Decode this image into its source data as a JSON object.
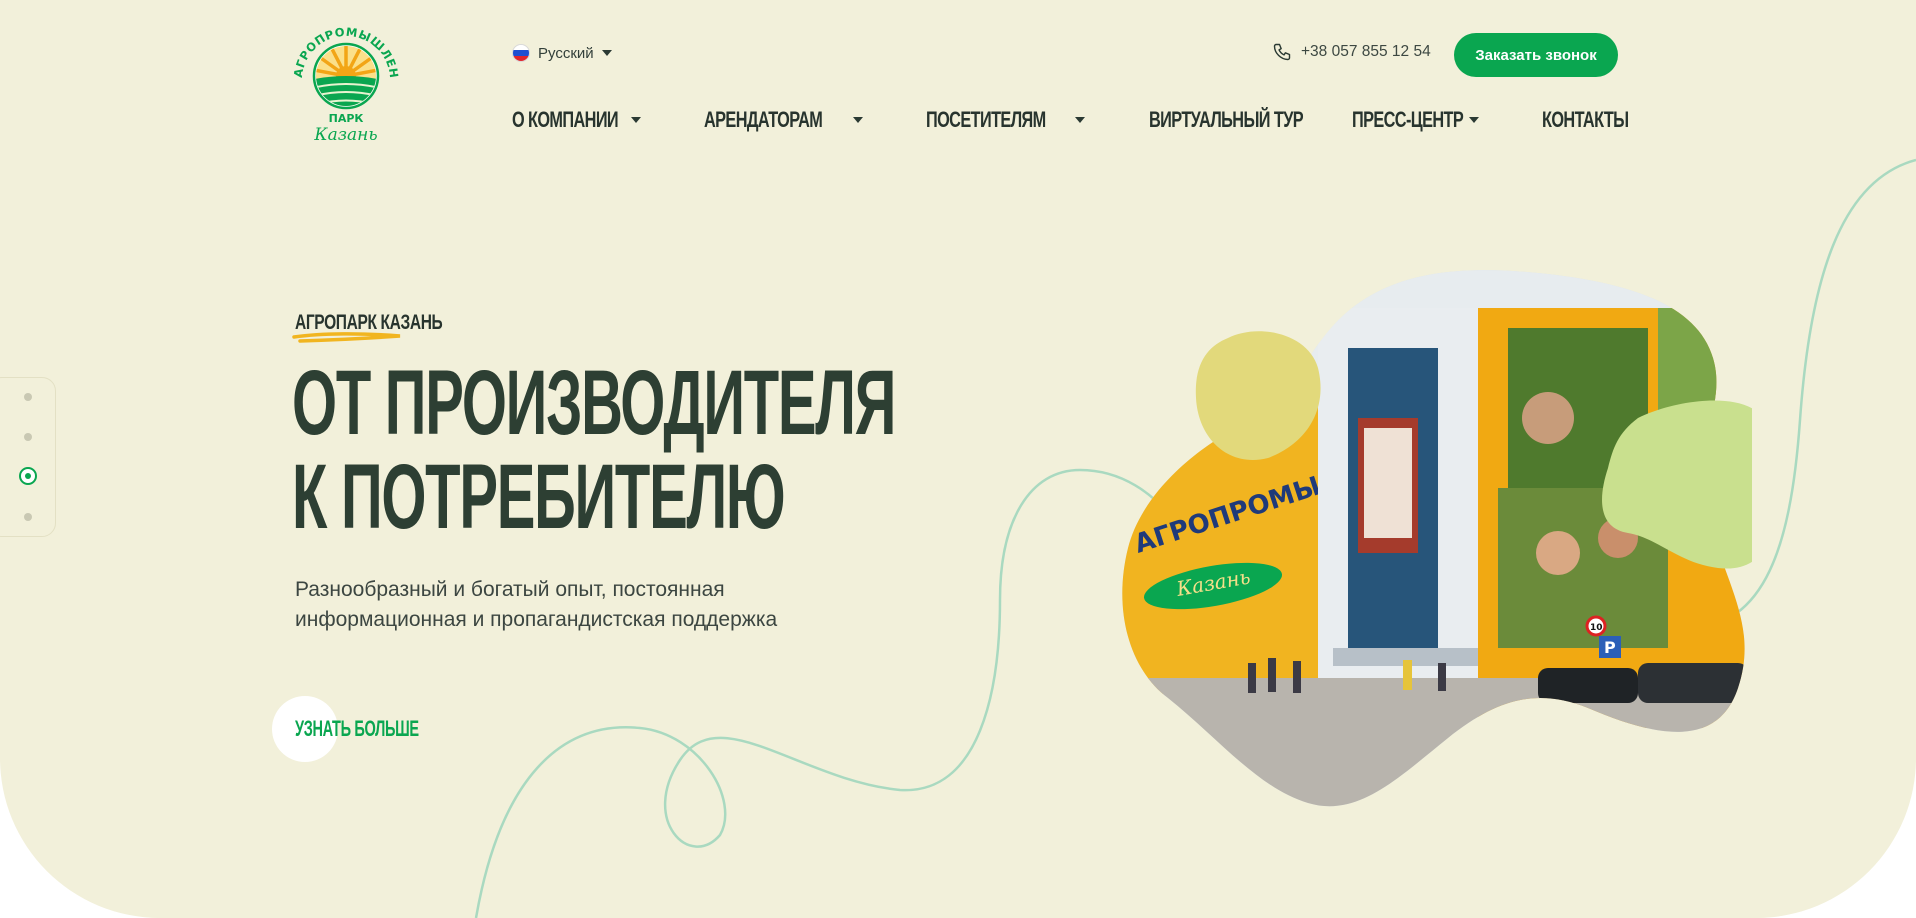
{
  "header": {
    "logo": {
      "arc_text": "АГРОПРОМЫШЛЕННЫЙ",
      "park_text": "ПАРК",
      "city_text": "Казань"
    },
    "language": {
      "label": "Русский",
      "flag": "ru-flag-icon"
    },
    "phone": {
      "number": "+38 057 855 12 54",
      "icon": "phone-icon"
    },
    "callback_button": "Заказать звонок"
  },
  "nav": {
    "items": [
      {
        "label": "О компании",
        "has_dropdown": true
      },
      {
        "label": "Арендаторам",
        "has_dropdown": true
      },
      {
        "label": "Посетителям",
        "has_dropdown": true
      },
      {
        "label": "Виртуальный тур",
        "has_dropdown": false
      },
      {
        "label": "Пресс-центр",
        "has_dropdown": true
      },
      {
        "label": "Контакты",
        "has_dropdown": false
      }
    ]
  },
  "hero": {
    "eyebrow": "Агропарк Казань",
    "title_line1": "От производителя",
    "title_line2": "к потребителю",
    "subtitle_line1": "Разнообразный и богатый опыт, постоянная",
    "subtitle_line2": "информационная и пропагандистская поддержка",
    "more_link": "Узнать больше",
    "slider": {
      "total": 4,
      "active_index": 3
    },
    "photo": {
      "building_sign": "АГРОПРОМЫШЛЕННЫЙ ПАРК",
      "building_sign2": "Казань",
      "speed_sign": "10",
      "parking_sign": "P"
    }
  },
  "colors": {
    "background": "#f2f0da",
    "accent_green": "#0aa650",
    "text_dark": "#2d3f33",
    "blob_yellow": "#e2d97b",
    "blob_green": "#c9e08e",
    "curve": "#a9d9c0",
    "underline": "#f1b520"
  }
}
